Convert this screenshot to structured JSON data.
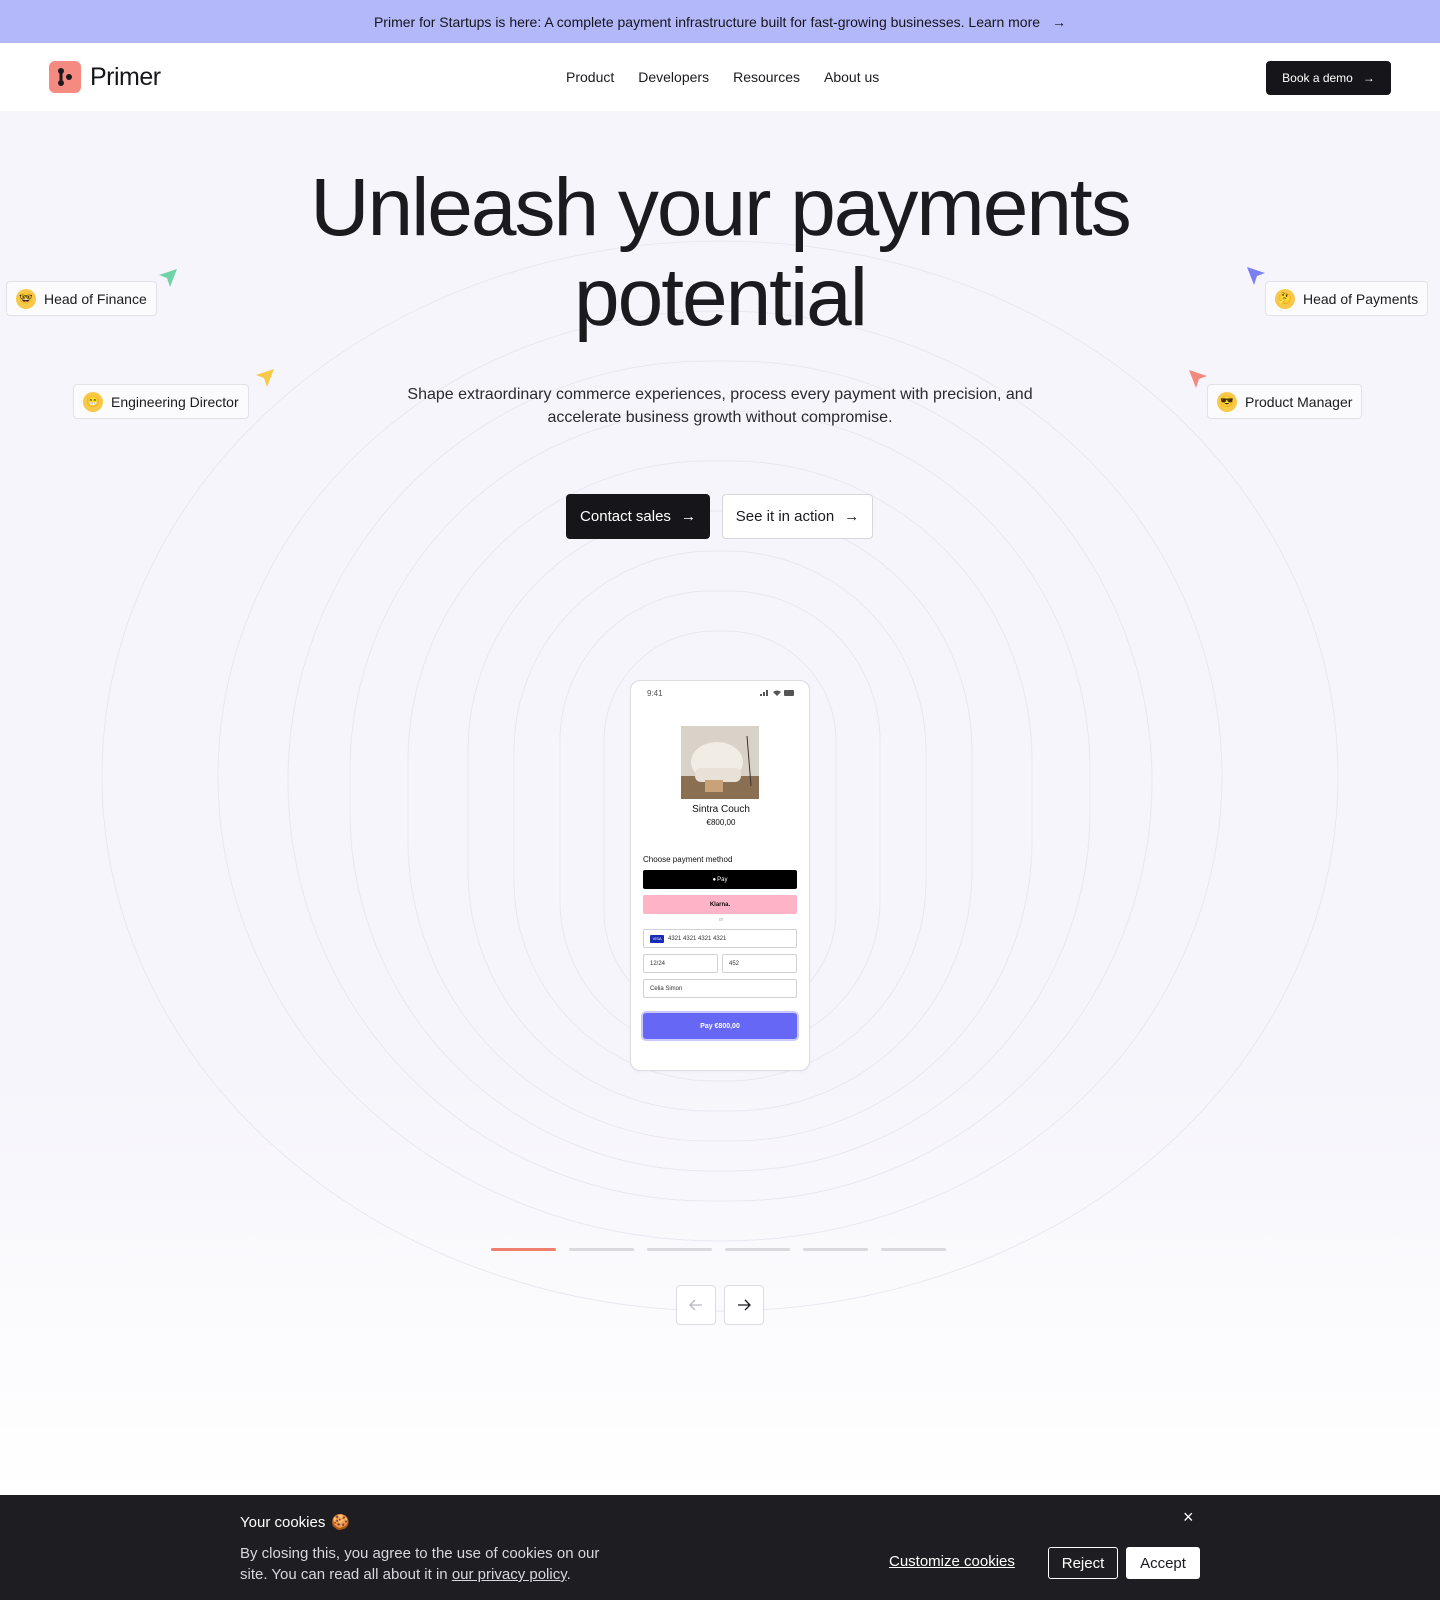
{
  "announcement": {
    "text": "Primer for Startups is here: A complete payment infrastructure built for fast-growing businesses. Learn more",
    "icon": "arrow-right-icon"
  },
  "header": {
    "logo_text": "Primer",
    "nav": [
      "Product",
      "Developers",
      "Resources",
      "About us"
    ],
    "cta": "Book a demo"
  },
  "hero": {
    "title_line1": "Unleash your payments",
    "title_line2": "potential",
    "subtitle_line1": "Shape extraordinary commerce experiences, process every payment with precision, and",
    "subtitle_line2": "accelerate business growth without compromise.",
    "primary_cta": "Contact sales",
    "secondary_cta": "See it in action"
  },
  "personas": {
    "head_of_finance": "Head of Finance",
    "engineering_director": "Engineering Director",
    "head_of_payments": "Head of Payments",
    "product_manager": "Product Manager"
  },
  "phone": {
    "time": "9:41",
    "product_name": "Sintra Couch",
    "product_price": "€800,00",
    "choose_label": "Choose payment method",
    "apple_pay": "Pay",
    "klarna": "Klarna.",
    "or": "or",
    "card_number": "4321 4321 4321 4321",
    "card_brand": "VISA",
    "expiry": "12/24",
    "cvc": "452",
    "name": "Celia Simon",
    "pay_button": "Pay €800,00"
  },
  "carousel": {
    "slides": 6,
    "active_index": 0
  },
  "cookie": {
    "title": "Your cookies",
    "text_line1": "By closing this, you agree to the use of cookies on our",
    "text_line2": "site. You can read all about it in",
    "link": "our privacy policy",
    "text_end": ".",
    "customize": "Customize cookies",
    "reject": "Reject",
    "accept": "Accept",
    "close": "×"
  },
  "colors": {
    "announcement_bg": "#b3b8fb",
    "logo": "#f58b80",
    "pay_button": "#6767f5",
    "carousel_active": "#f07e6e",
    "cursor_green": "#6fd3a8",
    "cursor_yellow": "#f7c948",
    "cursor_purple": "#7b7ff2",
    "cursor_red": "#f08a7e"
  }
}
